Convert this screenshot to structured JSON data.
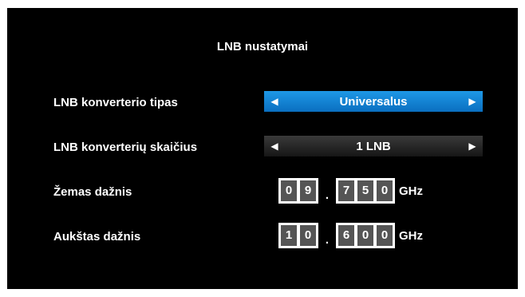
{
  "title": "LNB nustatymai",
  "rows": [
    {
      "label": "LNB konverterio tipas",
      "value": "Universalus"
    },
    {
      "label": "LNB konverterių skaičius",
      "value": "1 LNB"
    },
    {
      "label": "Žemas dažnis",
      "int": [
        "0",
        "9"
      ],
      "sep": ".",
      "frac": [
        "7",
        "5",
        "0"
      ],
      "unit": "GHz"
    },
    {
      "label": "Aukštas dažnis",
      "int": [
        "1",
        "0"
      ],
      "sep": ".",
      "frac": [
        "6",
        "0",
        "0"
      ],
      "unit": "GHz"
    }
  ],
  "icons": {
    "left": "arrow-left-icon",
    "right": "arrow-right-icon"
  },
  "colors": {
    "active": "#1a8ad8",
    "background": "#000000",
    "digit": "#555555"
  }
}
